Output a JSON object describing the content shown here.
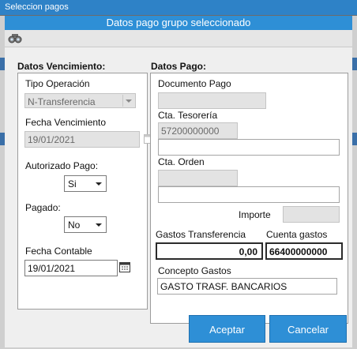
{
  "window": {
    "title": "Seleccion pagos"
  },
  "dialog": {
    "title": "Datos pago grupo seleccionado"
  },
  "toolbar": {
    "find_icon": "binoculars-icon"
  },
  "vencimiento": {
    "heading": "Datos Vencimiento:",
    "tipo_operacion_label": "Tipo Operación",
    "tipo_operacion_value": "N-Transferencia",
    "fecha_vencimiento_label": "Fecha Vencimiento",
    "fecha_vencimiento_value": "19/01/2021",
    "autorizado_label": "Autorizado Pago:",
    "autorizado_value": "Si",
    "pagado_label": "Pagado:",
    "pagado_value": "No",
    "fecha_contable_label": "Fecha Contable",
    "fecha_contable_value": "19/01/2021"
  },
  "pago": {
    "heading": "Datos Pago:",
    "documento_label": "Documento Pago",
    "documento_value": "",
    "cta_tesoreria_label": "Cta. Tesorería",
    "cta_tesoreria_value": "57200000000",
    "cta_tesoreria_desc": "",
    "cta_orden_label": "Cta. Orden",
    "cta_orden_value": "",
    "cta_orden_desc": "",
    "importe_label": "Importe",
    "importe_value": "",
    "gastos_transferencia_label": "Gastos Transferencia",
    "gastos_transferencia_value": "0,00",
    "cuenta_gastos_label": "Cuenta gastos",
    "cuenta_gastos_value": "66400000000",
    "concepto_label": "Concepto Gastos",
    "concepto_value": "GASTO TRASF. BANCARIOS"
  },
  "buttons": {
    "aceptar": "Aceptar",
    "cancelar": "Cancelar"
  },
  "colors": {
    "title_bar": "#2e8fd6",
    "button": "#2e8fd6"
  }
}
